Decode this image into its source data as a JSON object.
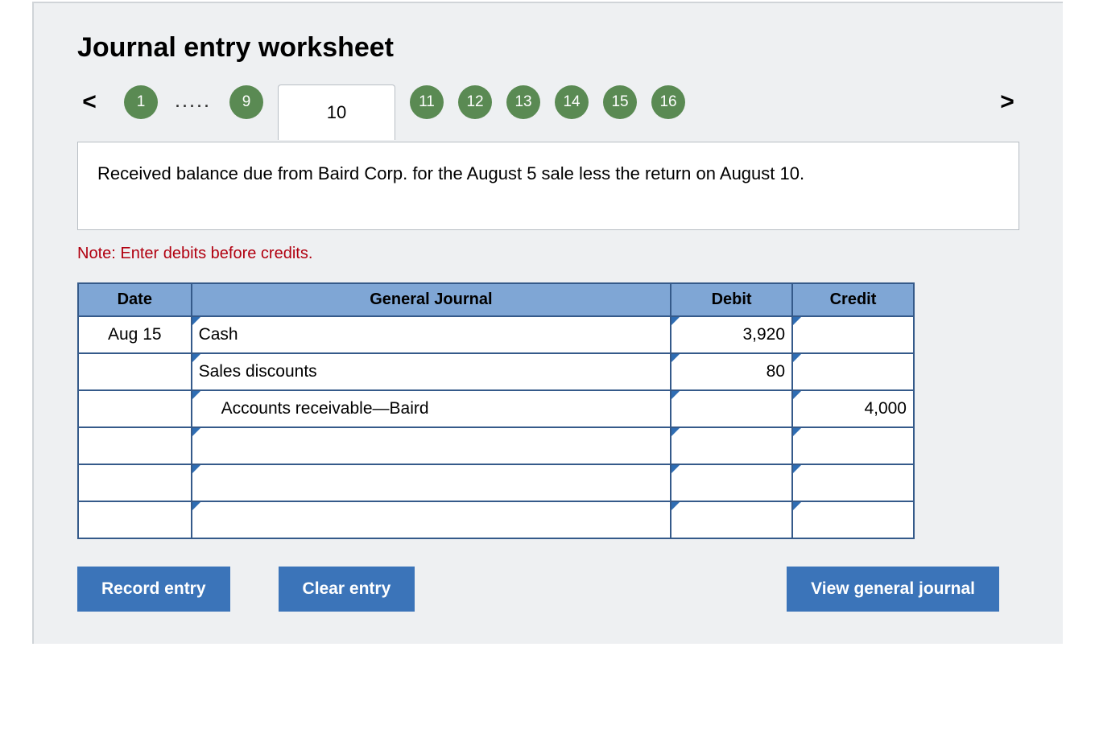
{
  "title": "Journal entry worksheet",
  "nav": {
    "prev": "<",
    "next": ">",
    "dots": ".....",
    "items": [
      {
        "label": "1",
        "active": false
      },
      {
        "label": "9",
        "active": false
      },
      {
        "label": "10",
        "active": true
      },
      {
        "label": "11",
        "active": false
      },
      {
        "label": "12",
        "active": false
      },
      {
        "label": "13",
        "active": false
      },
      {
        "label": "14",
        "active": false
      },
      {
        "label": "15",
        "active": false
      },
      {
        "label": "16",
        "active": false
      }
    ]
  },
  "description": "Received balance due from Baird Corp. for the August 5 sale less the return on August 10.",
  "note": "Note: Enter debits before credits.",
  "table": {
    "headers": {
      "date": "Date",
      "journal": "General Journal",
      "debit": "Debit",
      "credit": "Credit"
    },
    "rows": [
      {
        "date": "Aug 15",
        "account": "Cash",
        "indent": false,
        "debit": "3,920",
        "credit": ""
      },
      {
        "date": "",
        "account": "Sales discounts",
        "indent": false,
        "debit": "80",
        "credit": ""
      },
      {
        "date": "",
        "account": "Accounts receivable—Baird",
        "indent": true,
        "debit": "",
        "credit": "4,000"
      },
      {
        "date": "",
        "account": "",
        "indent": false,
        "debit": "",
        "credit": ""
      },
      {
        "date": "",
        "account": "",
        "indent": false,
        "debit": "",
        "credit": ""
      },
      {
        "date": "",
        "account": "",
        "indent": false,
        "debit": "",
        "credit": ""
      }
    ]
  },
  "buttons": {
    "record": "Record entry",
    "clear": "Clear entry",
    "view": "View general journal"
  }
}
